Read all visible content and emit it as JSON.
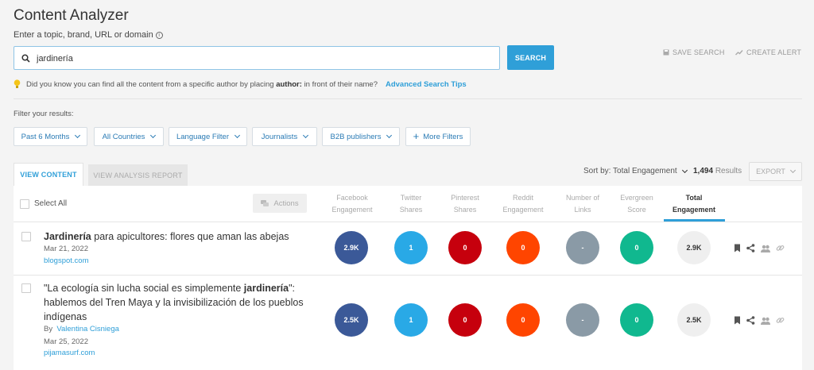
{
  "header": {
    "title": "Content Analyzer",
    "subtitle": "Enter a topic, brand, URL or domain",
    "info_glyph": "i"
  },
  "search": {
    "value": "jardinería",
    "button_label": "SEARCH",
    "save_label": "SAVE SEARCH",
    "alert_label": "CREATE ALERT"
  },
  "tip": {
    "text_before": "Did you know you can find all the content from a specific author by placing",
    "keyword": "author:",
    "text_after": "in front of their name?",
    "link_label": "Advanced Search Tips"
  },
  "filters": {
    "label": "Filter your results:",
    "items": [
      "Past 6 Months",
      "All Countries",
      "Language Filter",
      "Journalists",
      "B2B publishers"
    ],
    "more_label": "More Filters",
    "plus_glyph": "+"
  },
  "tabs": {
    "active": "VIEW CONTENT",
    "inactive": "VIEW ANALYSIS REPORT"
  },
  "sort": {
    "label": "Sort by: Total Engagement",
    "results_count": "1,494",
    "results_label": "Results",
    "export_label": "EXPORT"
  },
  "table": {
    "select_all": "Select All",
    "actions_label": "Actions",
    "columns": [
      {
        "line1": "Facebook",
        "line2": "Engagement"
      },
      {
        "line1": "Twitter",
        "line2": "Shares"
      },
      {
        "line1": "Pinterest",
        "line2": "Shares"
      },
      {
        "line1": "Reddit",
        "line2": "Engagement"
      },
      {
        "line1": "Number of",
        "line2": "Links"
      },
      {
        "line1": "Evergreen",
        "line2": "Score"
      },
      {
        "line1": "Total",
        "line2": "Engagement"
      }
    ],
    "rows": [
      {
        "title_bold": "Jardinería",
        "title_rest": " para apicultores: flores que aman las abejas",
        "date": "Mar 21, 2022",
        "domain": "blogspot.com",
        "facebook": "2.9K",
        "twitter": "1",
        "pinterest": "0",
        "reddit": "0",
        "links": "-",
        "evergreen": "0",
        "total": "2.9K"
      },
      {
        "title_line1_before": "\"La ecología sin lucha social es simplemente ",
        "title_line1_bold": "jardinería",
        "title_line1_after": "\":",
        "title_line2": "hablemos del Tren Maya y la invisibilización de los pueblos",
        "title_line3": "indígenas",
        "author_prefix": "By",
        "author": "Valentina Cisniega",
        "date": "Mar 25, 2022",
        "domain": "pijamasurf.com",
        "facebook": "2.5K",
        "twitter": "1",
        "pinterest": "0",
        "reddit": "0",
        "links": "-",
        "evergreen": "0",
        "total": "2.5K"
      }
    ]
  },
  "colors": {
    "accent": "#2f9fd8",
    "facebook": "#3b5998",
    "twitter": "#29a9e6",
    "pinterest": "#c6000d",
    "reddit": "#ff4500",
    "links": "#8a9aa6",
    "evergreen": "#10b88f"
  },
  "icons": [
    "info-icon",
    "search-icon",
    "save-icon",
    "trend-icon",
    "lightbulb-icon",
    "chevron-down-icon",
    "plus-icon",
    "chat-icon",
    "bookmark-icon",
    "share-icon",
    "users-icon",
    "link-icon"
  ]
}
